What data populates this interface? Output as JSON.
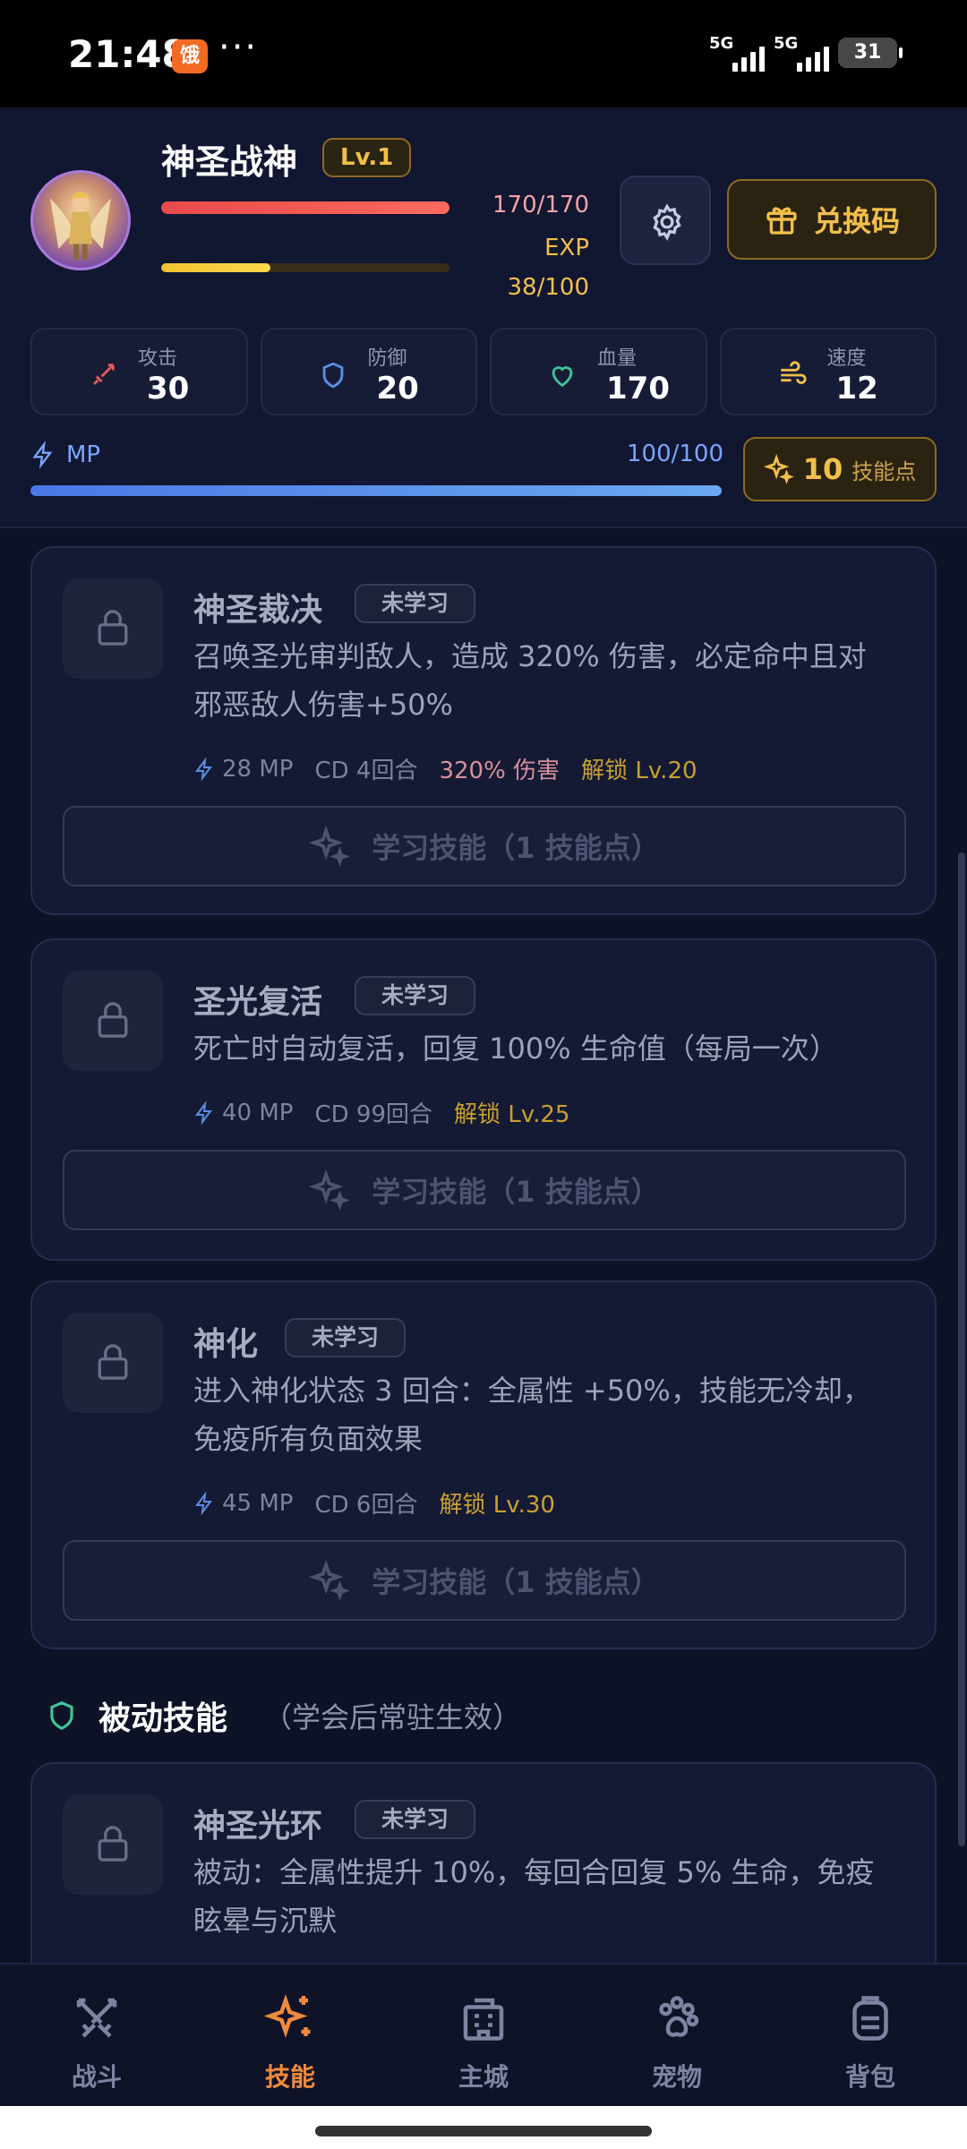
{
  "status_bar": {
    "time": "21:48",
    "app_icon_text": "饿",
    "dots": "···",
    "sim1": "5G",
    "sim2": "5G",
    "battery": "31"
  },
  "player": {
    "name": "神圣战神",
    "level": "Lv.1",
    "hp_text": "170/170",
    "hp_fraction": 1.0,
    "exp_label": "EXP",
    "exp_text": "38/100",
    "exp_fraction": 0.38,
    "redeem_label": "兑换码"
  },
  "stats": [
    {
      "label": "攻击",
      "value": "30",
      "icon": "sword-icon",
      "color": "#e05a5a"
    },
    {
      "label": "防御",
      "value": "20",
      "icon": "shield-icon",
      "color": "#5a8fe6"
    },
    {
      "label": "血量",
      "value": "170",
      "icon": "heart-icon",
      "color": "#3ec59a"
    },
    {
      "label": "速度",
      "value": "12",
      "icon": "wind-icon",
      "color": "#f2c04a"
    }
  ],
  "mp": {
    "label": "MP",
    "text": "100/100",
    "fraction": 1.0
  },
  "skill_points": {
    "count": "10",
    "label": "技能点"
  },
  "skills": [
    {
      "name": "神圣裁决",
      "status": "未学习",
      "desc_line1": "召唤圣光审判敌人，造成 320% 伤害，必定命中且对",
      "desc_line2": "邪恶敌人伤害+50%",
      "mp": "28 MP",
      "cd": "CD 4回合",
      "damage": "320% 伤害",
      "unlock": "解锁 Lv.20",
      "learn": "学习技能（1 技能点）"
    },
    {
      "name": "圣光复活",
      "status": "未学习",
      "desc_line1": "死亡时自动复活，回复 100% 生命值（每局一次）",
      "desc_line2": "",
      "mp": "40 MP",
      "cd": "CD 99回合",
      "damage": "",
      "unlock": "解锁 Lv.25",
      "learn": "学习技能（1 技能点）"
    },
    {
      "name": "神化",
      "status": "未学习",
      "desc_line1": "进入神化状态 3 回合：全属性 +50%，技能无冷却，",
      "desc_line2": "免疫所有负面效果",
      "mp": "45 MP",
      "cd": "CD 6回合",
      "damage": "",
      "unlock": "解锁 Lv.30",
      "learn": "学习技能（1 技能点）"
    }
  ],
  "passive_section": {
    "title": "被动技能",
    "subtitle": "（学会后常驻生效）"
  },
  "passive_skills": [
    {
      "name": "神圣光环",
      "status": "未学习",
      "desc_line1": "被动：全属性提升 10%，每回合回复 5% 生命，免疫",
      "desc_line2": "眩晕与沉默"
    }
  ],
  "bottom_nav": [
    {
      "label": "战斗",
      "icon": "crossed-swords-icon",
      "active": false
    },
    {
      "label": "技能",
      "icon": "sparkles-icon",
      "active": true
    },
    {
      "label": "主城",
      "icon": "building-icon",
      "active": false
    },
    {
      "label": "宠物",
      "icon": "paw-icon",
      "active": false
    },
    {
      "label": "背包",
      "icon": "backpack-icon",
      "active": false
    }
  ],
  "colors": {
    "background": "#0d1226",
    "accent_gold": "#f2c04a",
    "accent_orange": "#f08a3c",
    "mp_blue": "#7aa6ff"
  }
}
